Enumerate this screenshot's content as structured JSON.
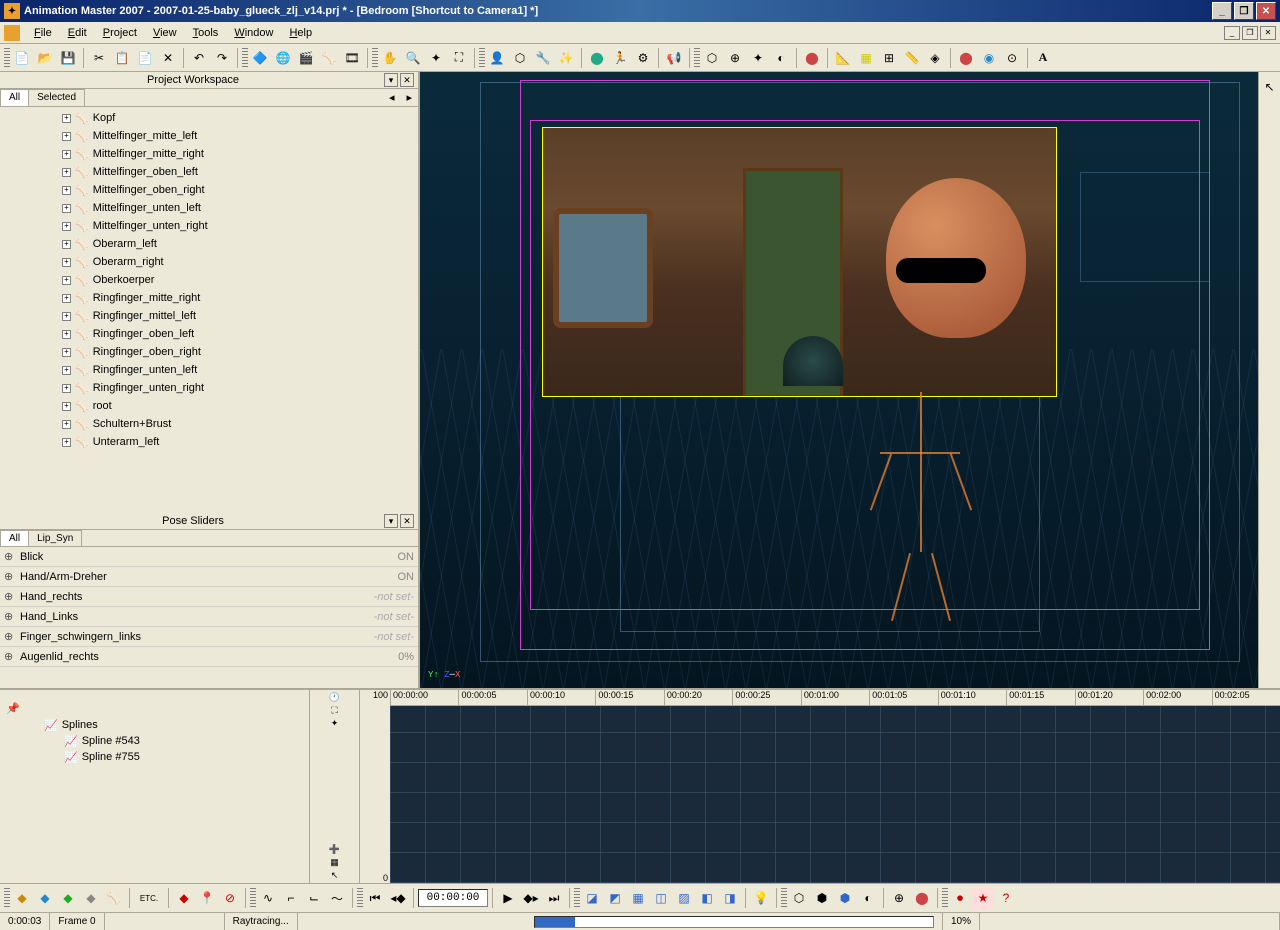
{
  "title": "Animation Master 2007 - 2007-01-25-baby_glueck_zlj_v14.prj * - [Bedroom [Shortcut to Camera1] *]",
  "menus": {
    "file": "File",
    "edit": "Edit",
    "project": "Project",
    "view": "View",
    "tools": "Tools",
    "window": "Window",
    "help": "Help"
  },
  "panels": {
    "workspace_title": "Project Workspace",
    "pose_title": "Pose Sliders"
  },
  "workspace_tabs": {
    "all": "All",
    "selected": "Selected"
  },
  "pose_tabs": {
    "all": "All",
    "lipsync": "Lip_Syn"
  },
  "tree": [
    "Kopf",
    "Mittelfinger_mitte_left",
    "Mittelfinger_mitte_right",
    "Mittelfinger_oben_left",
    "Mittelfinger_oben_right",
    "Mittelfinger_unten_left",
    "Mittelfinger_unten_right",
    "Oberarm_left",
    "Oberarm_right",
    "Oberkoerper",
    "Ringfinger_mitte_right",
    "Ringfinger_mittel_left",
    "Ringfinger_oben_left",
    "Ringfinger_oben_right",
    "Ringfinger_unten_left",
    "Ringfinger_unten_right",
    "root",
    "Schultern+Brust",
    "Unterarm_left"
  ],
  "sliders": [
    {
      "name": "Blick",
      "val": "ON"
    },
    {
      "name": "Hand/Arm-Dreher",
      "val": "ON"
    },
    {
      "name": "Hand_rechts",
      "val": "-not set-"
    },
    {
      "name": "Hand_Links",
      "val": "-not set-"
    },
    {
      "name": "Finger_schwingern_links",
      "val": "-not set-"
    },
    {
      "name": "Augenlid_rechts",
      "val": "0%"
    }
  ],
  "timeline": {
    "ticks": [
      "00:00:00",
      "00:00:05",
      "00:00:10",
      "00:00:15",
      "00:00:20",
      "00:00:25",
      "00:01:00",
      "00:01:05",
      "00:01:10",
      "00:01:15",
      "00:01:20",
      "00:02:00",
      "00:02:05"
    ],
    "y_top": "100",
    "y_bot": "0",
    "items": [
      "Splines",
      "Spline #543",
      "Spline #755"
    ],
    "etc": "ETC."
  },
  "playback": {
    "time": "00:00:00"
  },
  "status": {
    "elapsed": "0:00:03",
    "frame": "Frame 0",
    "task": "Raytracing...",
    "percent": "10%"
  }
}
